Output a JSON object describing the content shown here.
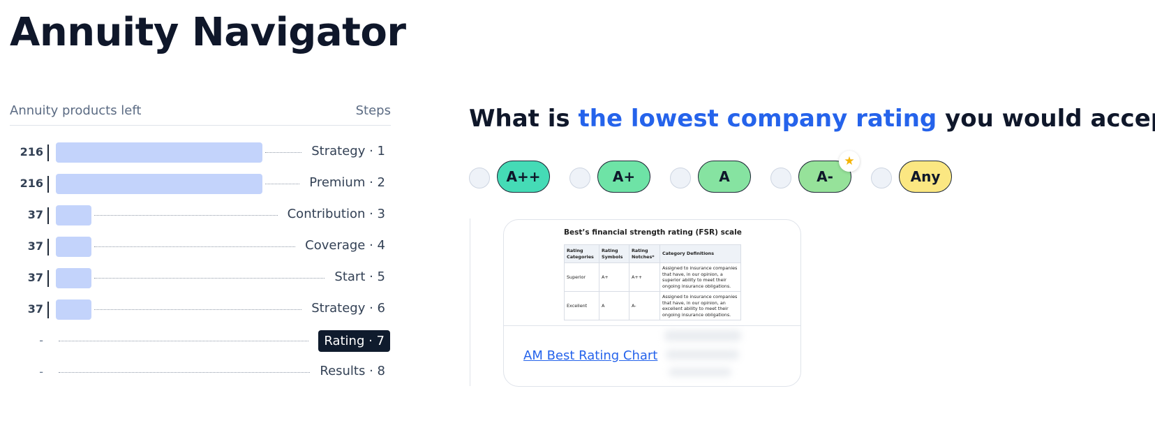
{
  "app": {
    "title": "Annuity Navigator"
  },
  "panel": {
    "left_header": "Annuity products left",
    "right_header": "Steps",
    "steps": [
      {
        "count": "216",
        "label": "Strategy · 1",
        "products": 216
      },
      {
        "count": "216",
        "label": "Premium · 2",
        "products": 216
      },
      {
        "count": "37",
        "label": "Contribution · 3",
        "products": 37
      },
      {
        "count": "37",
        "label": "Coverage · 4",
        "products": 37
      },
      {
        "count": "37",
        "label": "Start · 5",
        "products": 37
      },
      {
        "count": "37",
        "label": "Strategy · 6",
        "products": 37
      },
      {
        "count": "-",
        "label": "Rating · 7",
        "products": 0,
        "active": true
      },
      {
        "count": "-",
        "label": "Results · 8",
        "products": 0
      }
    ]
  },
  "question": {
    "prefix": "What is ",
    "highlight": "the lowest company rating",
    "suffix": " you would accept?"
  },
  "options": [
    {
      "label": "A++",
      "color": "#45dbb6"
    },
    {
      "label": "A+",
      "color": "#6ee3a6"
    },
    {
      "label": "A",
      "color": "#86e3a1"
    },
    {
      "label": "A-",
      "color": "#96e29a",
      "recommended": true,
      "badge": "star-icon"
    },
    {
      "label": "Any",
      "color": "#fbe782"
    }
  ],
  "card": {
    "preview_title": "Best’s financial strength rating (FSR) scale",
    "table_headers": [
      "Rating Categories",
      "Rating Symbols",
      "Rating Notches*",
      "Category Definitions"
    ],
    "table_rows": [
      [
        "Superior",
        "A+",
        "A++",
        "Assigned to insurance companies that have, in our opinion, a superior ability to meet their ongoing insurance obligations."
      ],
      [
        "Excellent",
        "A",
        "A-",
        "Assigned to insurance companies that have, in our opinion, an excellent ability to meet their ongoing insurance obligations."
      ]
    ],
    "link_text": "AM Best Rating Chart"
  },
  "colors": {
    "accent": "#2563eb",
    "bar": "#c3d3fb",
    "active_step_bg": "#0f1b2d"
  }
}
